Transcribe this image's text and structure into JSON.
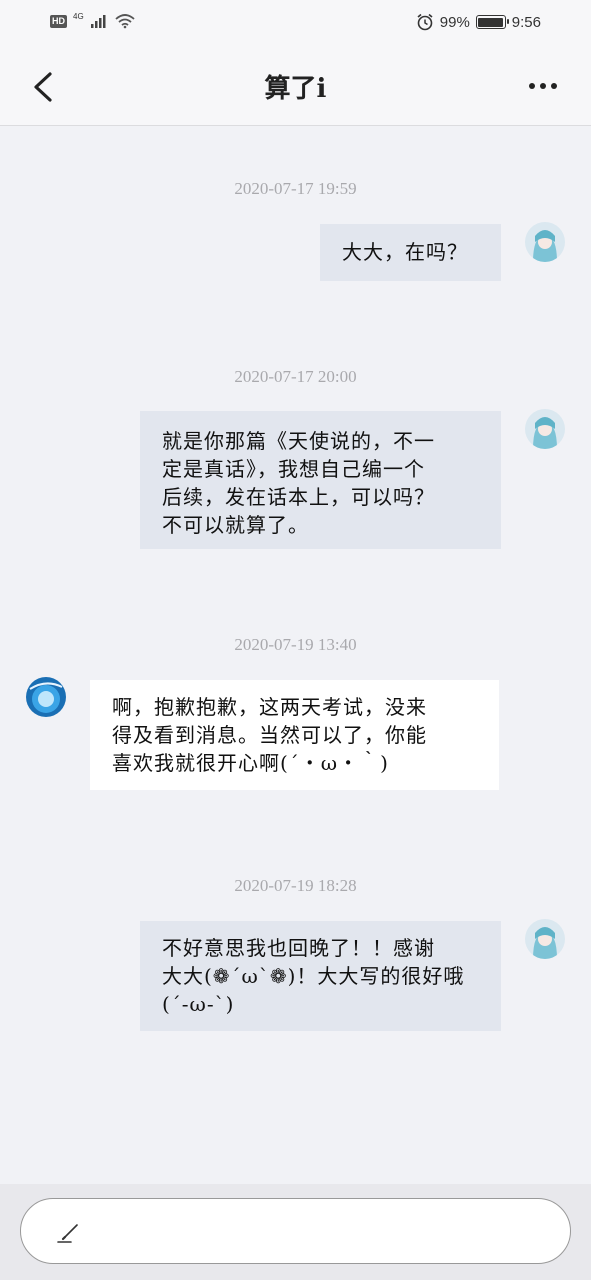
{
  "status_bar": {
    "hd": "HD",
    "network": "4G",
    "battery_percent": "99%",
    "time": "9:56",
    "battery_level": 0.99
  },
  "header": {
    "title": "算了i",
    "back_icon": "chevron-left-icon",
    "more_icon": "more-dots-icon"
  },
  "messages": [
    {
      "timestamp": "2020-07-17 19:59",
      "direction": "outgoing",
      "text": "大大，在吗？"
    },
    {
      "timestamp": "2020-07-17 20:00",
      "direction": "outgoing",
      "text": "就是你那篇《天使说的，不一\n定是真话》，我想自己编一个\n后续，发在话本上，可以吗？\n不可以就算了。"
    },
    {
      "timestamp": "2020-07-19 13:40",
      "direction": "incoming",
      "text": "啊，抱歉抱歉，这两天考试，没来\n得及看到消息。当然可以了，你能\n喜欢我就很开心啊(´・ω・｀)"
    },
    {
      "timestamp": "2020-07-19 18:28",
      "direction": "outgoing",
      "text": "不好意思我也回晚了！！感谢\n大大(❁´ω`❁)！大大写的很好哦\n(´-ω-`)"
    }
  ],
  "composer": {
    "icon": "pen-icon"
  },
  "colors": {
    "background": "#f1f2f6",
    "outgoing_bubble": "#e2e6ee",
    "incoming_bubble": "#ffffff",
    "timestamp": "#a9a9ad"
  }
}
